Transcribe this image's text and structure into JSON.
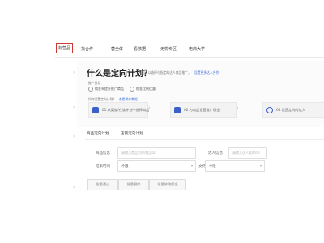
{
  "nav": {
    "tabs": [
      "标营品",
      "找合作",
      "营全体",
      "看数据",
      "无忧专区",
      "电商大学"
    ]
  },
  "intro": {
    "title": "什么是定向计划？",
    "subtitle": "您可以选择与指定的达人商品推广，",
    "link": "设置更多达人合作",
    "section_label": "推广目标",
    "options": [
      "佣金率提升推广商品",
      "佣金比例优惠"
    ],
    "flow_label": "如何设置定向计划？",
    "flow_link": "查看操作教程",
    "steps": [
      "01.从渠道/在该计划中选择商品",
      "02.为商品设置推广佣金",
      "03.设置定向的达人"
    ]
  },
  "filters": {
    "tabs": [
      "商品定向计划",
      "店铺定向计划"
    ],
    "fields": {
      "product_label": "商品信息",
      "product_placeholder": "请输入商品名称/商品ID",
      "talent_label": "达人信息",
      "talent_placeholder": "请输入达人昵称/ID",
      "end_time_label": "结束时间",
      "end_time_value": "不限",
      "public_label": "支持公开申请",
      "public_value": "不限"
    },
    "buttons": [
      "批量通过",
      "批量删除",
      "批量修改佣金"
    ]
  }
}
